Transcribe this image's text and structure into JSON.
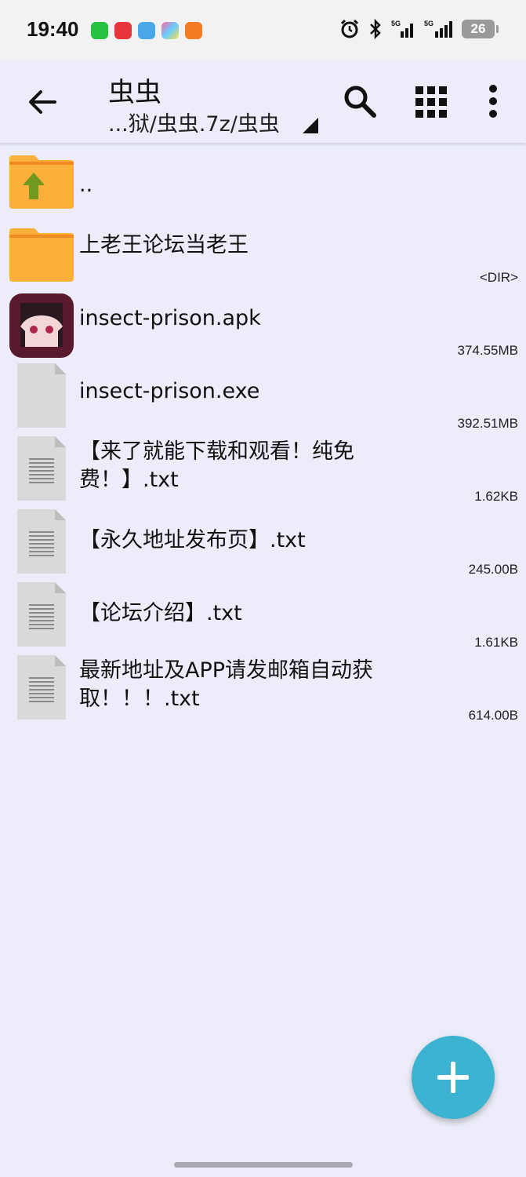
{
  "status_bar": {
    "time": "19:40",
    "notification_icons": [
      "wechat-icon",
      "music-icon",
      "weather-icon",
      "photos-icon",
      "app-icon"
    ],
    "signal_label_1": "5G",
    "signal_label_2": "5G",
    "battery": "26"
  },
  "appbar": {
    "title": "虫虫",
    "path": "...狱/虫虫.7z/虫虫"
  },
  "files": [
    {
      "name": "..",
      "meta": "",
      "type": "parent-folder"
    },
    {
      "name": "上老王论坛当老王",
      "meta": "<DIR>",
      "type": "folder"
    },
    {
      "name": "insect-prison.apk",
      "meta": "374.55MB",
      "type": "apk"
    },
    {
      "name": "insect-prison.exe",
      "meta": "392.51MB",
      "type": "file"
    },
    {
      "name": "【来了就能下载和观看！纯免费！】.txt",
      "meta": "1.62KB",
      "type": "text"
    },
    {
      "name": "【永久地址发布页】.txt",
      "meta": "245.00B",
      "type": "text"
    },
    {
      "name": "【论坛介绍】.txt",
      "meta": "1.61KB",
      "type": "text"
    },
    {
      "name": "最新地址及APP请发邮箱自动获取！！！.txt",
      "meta": "614.00B",
      "type": "text"
    }
  ],
  "colors": {
    "background": "#ecedf8",
    "folder": "#fbb03b",
    "folder_tab": "#f08a24",
    "up_arrow": "#6f9a1f",
    "fab": "#3bb3d1"
  }
}
